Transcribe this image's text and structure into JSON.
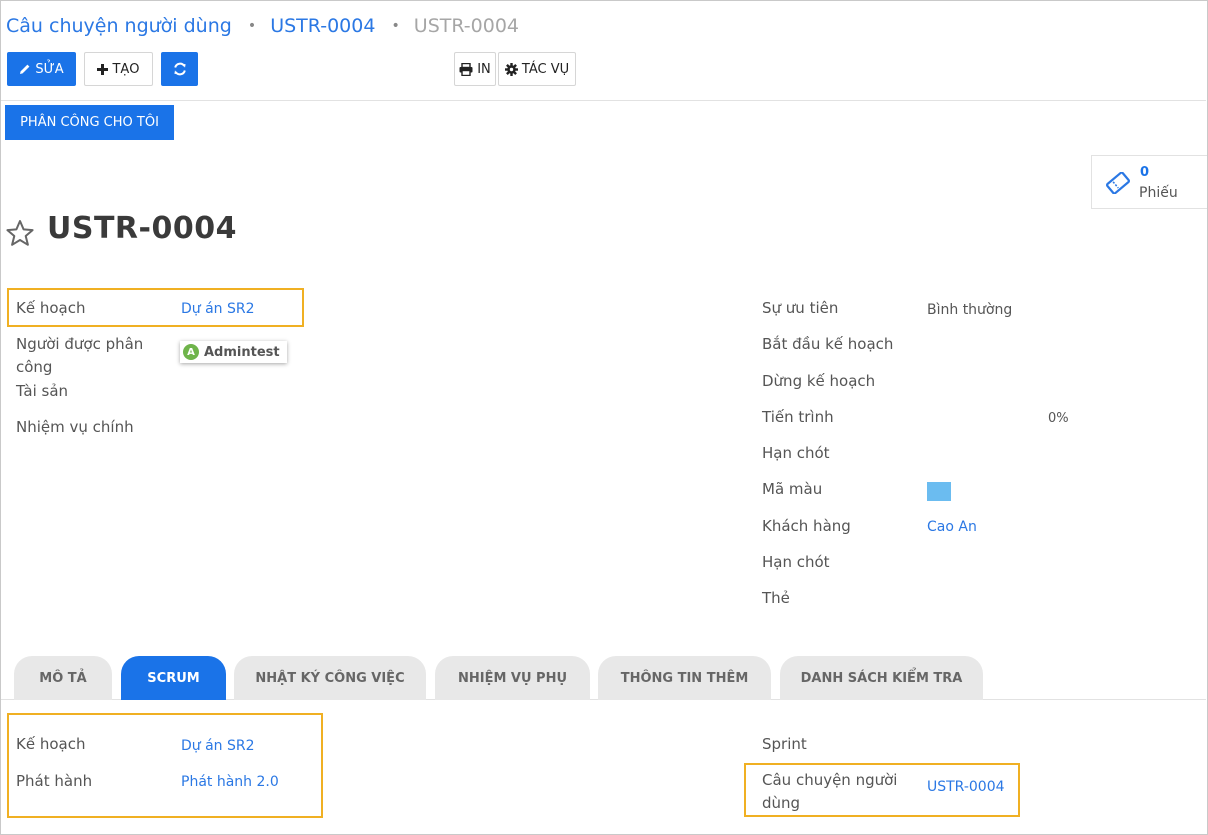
{
  "breadcrumb": {
    "section": "Câu chuyện người dùng",
    "parent": "USTR-0004",
    "current": "USTR-0004"
  },
  "toolbar": {
    "edit_label": "SỬA",
    "create_label": "TẠO",
    "print_label": "IN",
    "action_label": "TÁC VỤ"
  },
  "assign_me_label": "PHÂN CÔNG CHO TÔI",
  "stat": {
    "count": "0",
    "label": "Phiếu"
  },
  "record": {
    "title": "USTR-0004"
  },
  "left_fields": {
    "plan_label": "Kế hoạch",
    "plan_value": "Dự án SR2",
    "assignee_label": "Người được phân công",
    "assignee_initial": "A",
    "assignee_value": "Admintest",
    "asset_label": "Tài sản",
    "parent_task_label": "Nhiệm vụ chính"
  },
  "right_fields": {
    "priority_label": "Sự ưu tiên",
    "priority_value": "Bình thường",
    "plan_start_label": "Bắt đầu kế hoạch",
    "plan_stop_label": "Dừng kế hoạch",
    "progress_label": "Tiến trình",
    "progress_value": "0%",
    "deadline_label": "Hạn chót",
    "color_label": "Mã màu",
    "color_value": "#6bbcf0",
    "customer_label": "Khách hàng",
    "customer_value": "Cao An",
    "deadline2_label": "Hạn chót",
    "tag_label": "Thẻ"
  },
  "tabs": [
    {
      "label": "MÔ TẢ",
      "active": false
    },
    {
      "label": "SCRUM",
      "active": true
    },
    {
      "label": "NHẬT KÝ CÔNG VIỆC",
      "active": false
    },
    {
      "label": "NHIỆM VỤ PHỤ",
      "active": false
    },
    {
      "label": "THÔNG TIN THÊM",
      "active": false
    },
    {
      "label": "DANH SÁCH KIỂM TRA",
      "active": false
    }
  ],
  "scrum": {
    "plan_label": "Kế hoạch",
    "plan_value": "Dự án SR2",
    "release_label": "Phát hành",
    "release_value": "Phát hành 2.0",
    "sprint_label": "Sprint",
    "story_label": "Câu chuyện người dùng",
    "story_value": "USTR-0004"
  },
  "colors": {
    "primary": "#1a73e8",
    "link": "#2b78e4",
    "highlight": "#f0b023"
  }
}
